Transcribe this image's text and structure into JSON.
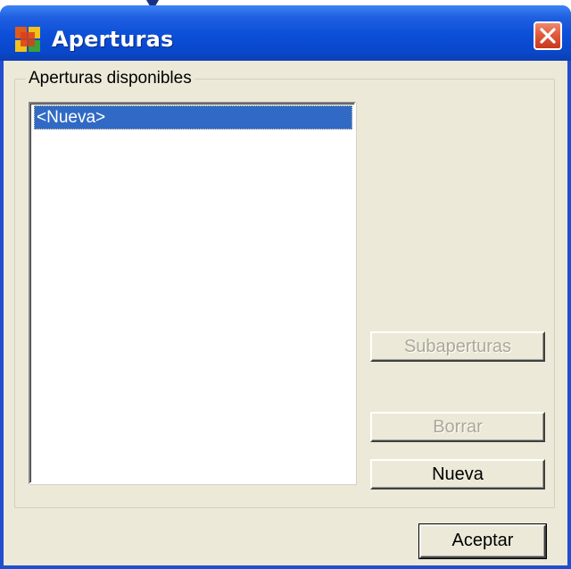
{
  "window": {
    "title": "Aperturas",
    "accent": "#0a47c9"
  },
  "group": {
    "label": "Aperturas disponibles"
  },
  "list": {
    "items": [
      {
        "label": "<Nueva>",
        "selected": true
      }
    ],
    "selected_color": "#316ac5"
  },
  "buttons": {
    "subaperturas": {
      "label": "Subaperturas",
      "enabled": false
    },
    "borrar": {
      "label": "Borrar",
      "enabled": false
    },
    "nueva": {
      "label": "Nueva",
      "enabled": true
    },
    "aceptar": {
      "label": "Aceptar",
      "enabled": true
    }
  },
  "icons": {
    "app": "app-icon",
    "close": "close-icon"
  }
}
